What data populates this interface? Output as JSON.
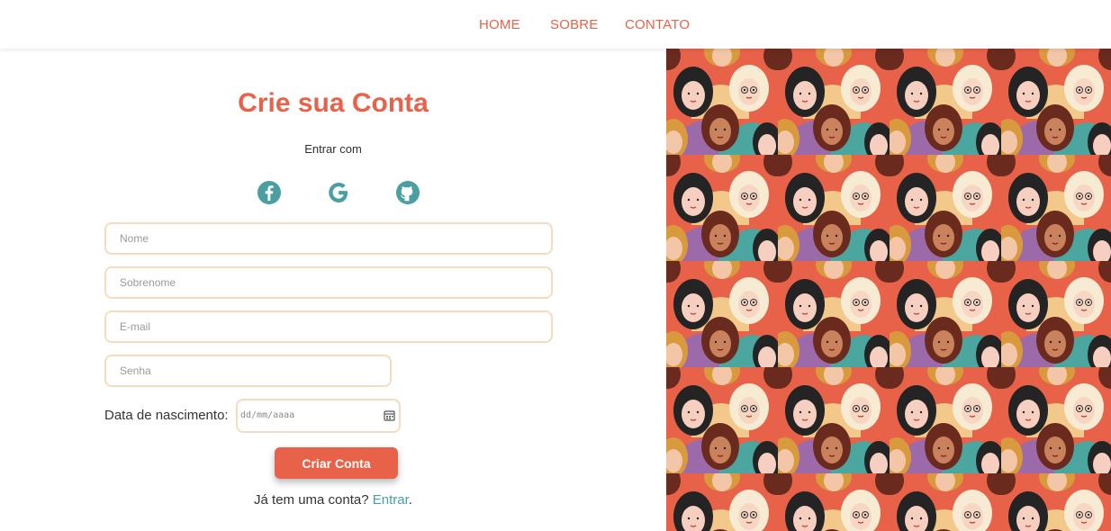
{
  "nav": {
    "items": [
      "HOME",
      "SOBRE",
      "CONTATO"
    ],
    "color": "#e8624a"
  },
  "form": {
    "title": "Crie sua Conta",
    "subtitle": "Entrar com",
    "social_icons": [
      "facebook-icon",
      "google-icon",
      "github-icon"
    ],
    "social_color": "#4a9fa0",
    "fields": {
      "nome_placeholder": "Nome",
      "sobrenome_placeholder": "Sobrenome",
      "email_placeholder": "E-mail",
      "senha_placeholder": "Senha"
    },
    "birth_label": "Data de nascimento:",
    "date_placeholder": "dd/mm/aaaa",
    "submit_label": "Criar Conta",
    "login_prompt": "Já tem uma conta?",
    "login_link": "Entrar",
    "login_period": "."
  },
  "colors": {
    "accent": "#e8624a",
    "teal": "#4a9fa0",
    "field_border": "#f4dcbf"
  },
  "illustration": {
    "description_icon": "crowd-of-women-pattern"
  }
}
